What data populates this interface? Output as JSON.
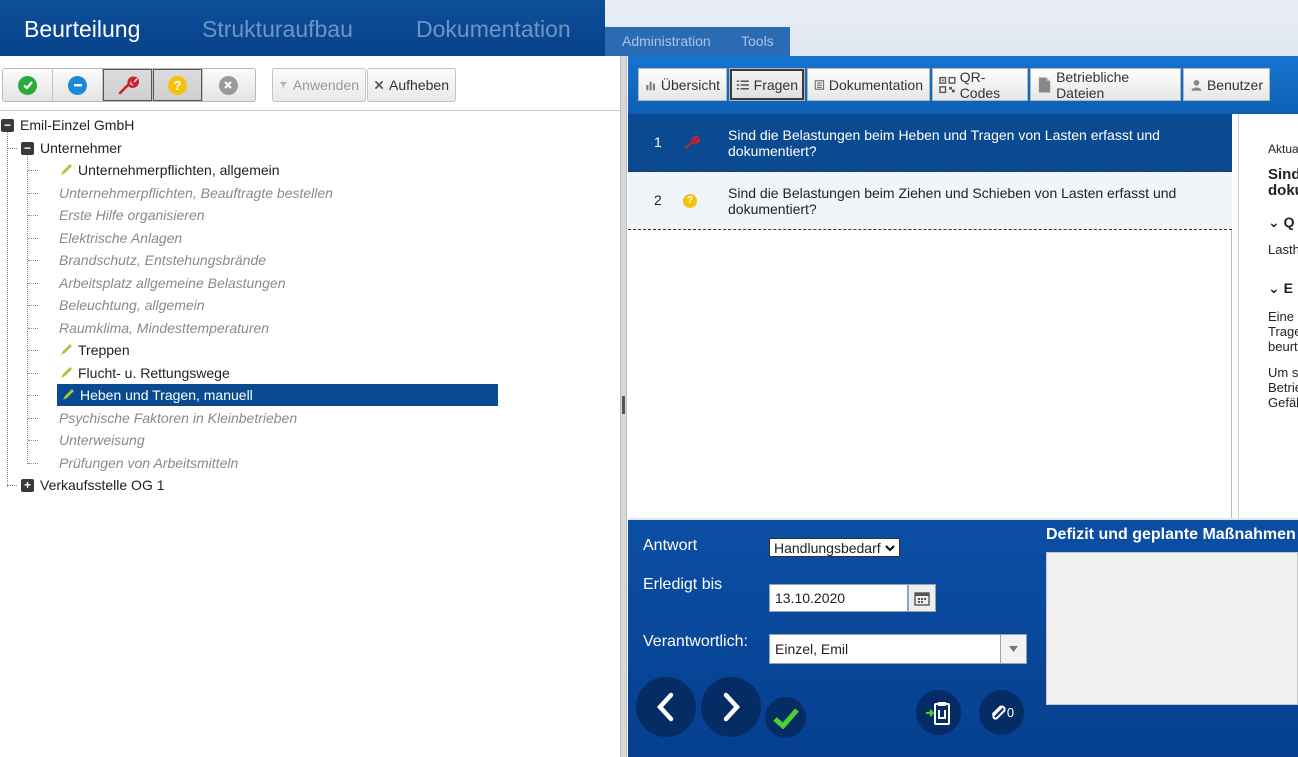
{
  "topnav": {
    "tabs": [
      "Beurteilung",
      "Strukturaufbau",
      "Dokumentation"
    ],
    "sub_tabs": [
      "Administration",
      "Tools"
    ]
  },
  "left_toolbar": {
    "status_buttons": [
      "check-icon",
      "minus-icon",
      "wrench-icon",
      "question-icon",
      "x-icon"
    ],
    "apply_label": "Anwenden",
    "cancel_label": "Aufheben"
  },
  "tree": {
    "root": "Emil-Einzel GmbH",
    "group": "Unternehmer",
    "items": [
      {
        "label": "Unternehmerpflichten, allgemein",
        "state": "edited"
      },
      {
        "label": "Unternehmerpflichten, Beauftragte bestellen",
        "state": "muted"
      },
      {
        "label": "Erste Hilfe organisieren",
        "state": "muted"
      },
      {
        "label": "Elektrische Anlagen",
        "state": "muted"
      },
      {
        "label": "Brandschutz, Entstehungsbrände",
        "state": "muted"
      },
      {
        "label": "Arbeitsplatz allgemeine Belastungen",
        "state": "muted"
      },
      {
        "label": "Beleuchtung, allgemein",
        "state": "muted"
      },
      {
        "label": "Raumklima, Mindesttemperaturen",
        "state": "muted"
      },
      {
        "label": "Treppen",
        "state": "edited"
      },
      {
        "label": "Flucht- u. Rettungswege",
        "state": "edited"
      },
      {
        "label": "Heben und Tragen, manuell",
        "state": "selected"
      },
      {
        "label": "Psychische Faktoren in Kleinbetrieben",
        "state": "muted"
      },
      {
        "label": "Unterweisung",
        "state": "muted"
      },
      {
        "label": "Prüfungen von Arbeitsmitteln",
        "state": "muted"
      }
    ],
    "second_root": "Verkaufsstelle OG 1"
  },
  "right_toolbar": {
    "tabs": [
      "Übersicht",
      "Fragen",
      "Dokumentation",
      "QR-Codes",
      "Betriebliche Dateien",
      "Benutzer"
    ]
  },
  "questions": [
    {
      "num": "1",
      "icon": "wrench-icon",
      "text": "Sind die Belastungen beim Heben und Tragen von Lasten erfasst und dokumentiert?"
    },
    {
      "num": "2",
      "icon": "question-icon",
      "text": "Sind die Belastungen beim Ziehen und Schieben von Lasten erfasst und dokumentiert?"
    }
  ],
  "detail": {
    "aktua": "Aktua",
    "sind": "Sind",
    "doku": "doku",
    "sec_q": "Q",
    "lasth": "Lasth",
    "sec_e": "E",
    "p1": [
      "Eine",
      "Trage",
      "beurt"
    ],
    "p2": [
      "Um s",
      "Betrie",
      "Gefäl"
    ]
  },
  "answer": {
    "antwort_label": "Antwort",
    "antwort_value": "Handlungsbedarf",
    "erledigt_label": "Erledigt bis",
    "erledigt_value": "13.10.2020",
    "verantwortlich_label": "Verantwortlich:",
    "verantwortlich_value": "Einzel, Emil",
    "attachment_count": "0",
    "defizit_title": "Defizit und geplante Maßnahmen"
  },
  "colors": {
    "nav_blue": "#0e4f9a",
    "selected": "#0a4a91",
    "green": "#2eaa3a",
    "blue": "#1a8ad8",
    "red": "#d0202a",
    "yellow": "#f4c20d",
    "grey": "#9a9a9a"
  }
}
